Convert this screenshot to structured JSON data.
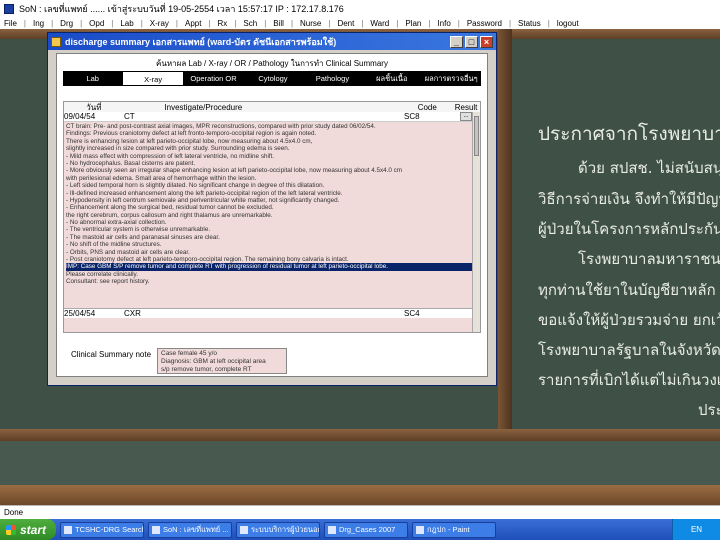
{
  "app": {
    "title": "SoN : เลขที่แพทย์ ...... เข้าสู่ระบบวันที่ 19-05-2554 เวลา 15:57:17 IP : 172.17.8.176",
    "menu": [
      "File",
      "Ing",
      "Drg",
      "Opd",
      "Lab",
      "X-ray",
      "Appt",
      "Rx",
      "Sch",
      "Bill",
      "Nurse",
      "Dent",
      "Ward",
      "Plan",
      "Info",
      "Password",
      "Status",
      "logout"
    ]
  },
  "dialog": {
    "title": "discharge summary เอกสารแพทย์ (ward-บัตร ดัชนีเอกสารพร้อมใช้)",
    "subheader": "ค้นหาผล Lab / X-ray / OR / Pathology ในการทำ Clinical Summary",
    "tabs": [
      "Lab",
      "X-ray",
      "Operation OR",
      "Cytology",
      "Pathology",
      "ผลชิ้นเนื้อ",
      "ผลการตรวจอื่นๆ"
    ],
    "active_tab": 1,
    "grid": {
      "headers": [
        "วันที่",
        "Investigate/Procedure",
        "",
        "Code",
        "Result"
      ],
      "first_row": {
        "date": "09/04/54",
        "procedure": "CT",
        "code": "SC8",
        "combo": "..."
      },
      "report_lines": [
        "CT brain: Pre- and post-contrast axial images, MPR reconstructions, compared with prior study dated 06/02/54.",
        "Findings: Previous craniotomy defect at left fronto-temporo-occipital region is again noted.",
        "There is enhancing lesion at left parieto-occipital lobe, now measuring about 4.5x4.0 cm,",
        "slightly increased in size compared with prior study. Surrounding edema is seen.",
        "- Mild mass effect with compression of left lateral ventricle, no midline shift.",
        "- No hydrocephalus. Basal cisterns are patent.",
        "- More obviously seen an irregular shape enhancing lesion at left parieto-occipital lobe, now measuring about 4.5x4.0 cm",
        "  with perilesional edema. Small area of hemorrhage within the lesion.",
        "- Left sided temporal horn is slightly dilated. No significant change in degree of this dilatation.",
        "- Ill-defined increased enhancement along the left parieto-occipital region of the left lateral ventricle.",
        "- Hypodensity in left centrum semiovale and periventricular white matter, not significantly changed.",
        "- Enhancement along the surgical bed, residual tumor cannot be excluded.",
        "  the right cerebrum, corpus callosum and right thalamus are unremarkable.",
        "- No abnormal extra-axial collection.",
        "- The ventricular system is otherwise unremarkable.",
        "- The mastoid air cells and paranasal sinuses are clear.",
        "- No shift of the midline structures.",
        "- Orbits, PNS and mastoid air cells are clear.",
        "- Post craniotomy defect at left parieto-temporo-occipital region. The remaining bony calvaria is intact.",
        "IMP: Case GBM S/P remove tumor and complete RT with progression of residual tumor at left parieto-occipital lobe.",
        "  Please correlate clinically.",
        "Consultant: see report history."
      ],
      "selected_line": 19,
      "second_row": {
        "date": "25/04/54",
        "procedure": "CXR",
        "code": "SC4"
      }
    },
    "clinical_summary": {
      "label": "Clinical Summary note",
      "lines": [
        "Case female 45 y/o",
        "Diagnosis: GBM at left occipital area",
        "s/p remove tumor, complete RT"
      ]
    }
  },
  "board": {
    "heading": "ประกาศจากโรงพยาบาล",
    "lines": [
      "ด้วย สปสช. ไม่สนับสนุนให้",
      "วิธีการจ่ายเงิน จึงทำให้มีปัญหา",
      "ผู้ป่วยในโครงการหลักประกันสุข",
      "โรงพยาบาลมหาราชนครเชียงใหม่",
      "ทุกท่านใช้ยาในบัญชียาหลัก หรือ",
      "ขอแจ้งให้ผู้ป่วยรวมจ่าย ยกเว้น",
      "โรงพยาบาลรัฐบาลในจังหวัดเชียงใหม่",
      "รายการที่เบิกได้แต่ไม่เกินวงเงิน",
      "ประกาศ"
    ]
  },
  "status": {
    "text": "Done"
  },
  "taskbar": {
    "start_label": "start",
    "tasks": [
      "TCSHC-DRG Search",
      "SoN : เลขที่แพทย์ ...",
      "ระบบบริการผู้ป่วยนอก",
      "Drg_Cases 2007",
      "กฎปก - Paint"
    ],
    "tray": "EN"
  }
}
